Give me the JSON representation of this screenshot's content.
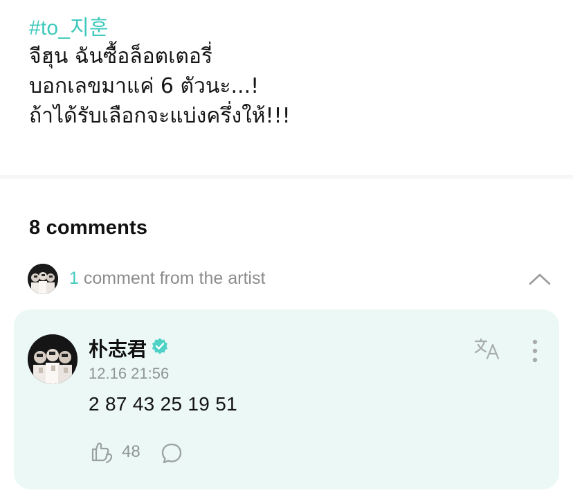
{
  "post": {
    "hashtag": "#to_지훈",
    "lines": [
      "จีฮุน ฉันซื้อล็อตเตอรี่",
      "บอกเลขมาแค่ 6 ตัวนะ...!",
      "ถ้าได้รับเลือกจะแบ่งครึ่งให้!!!"
    ]
  },
  "comments": {
    "count_label": "8 comments",
    "artist_summary": {
      "count": "1",
      "label": " comment from the artist",
      "expand_icon": "chevron-up-icon"
    },
    "artist_comment": {
      "author": "朴志君",
      "verified_icon": "verified-badge-icon",
      "timestamp": "12.16 21:56",
      "body": "2 87 43 25 19 51",
      "likes": "48",
      "translate_icon": "translate-icon",
      "more_icon": "more-vertical-icon",
      "like_icon": "like-icon",
      "reply_icon": "reply-bubble-icon"
    }
  },
  "colors": {
    "accent": "#3fc9bd",
    "card_background": "#ebf8f5",
    "muted_text": "#8f9694"
  }
}
